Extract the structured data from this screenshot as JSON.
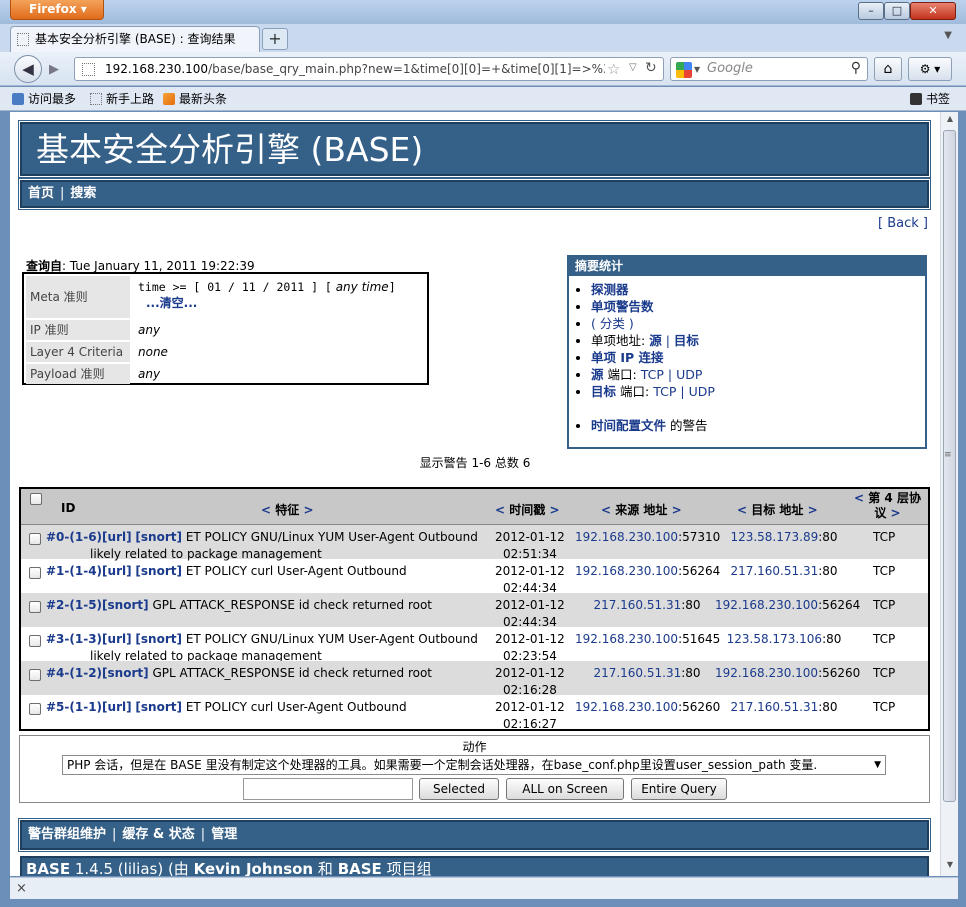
{
  "browser": {
    "app_button": "Firefox",
    "window_buttons": {
      "minimize": "–",
      "maximize": "□",
      "close": "✕"
    },
    "tab_title": "基本安全分析引擎 (BASE) : 查询结果",
    "new_tab": "+",
    "url_host": "192.168.230.100",
    "url_path": "/base/base_qry_main.php?new=1&time[0][0]=+&time[0][1]=>%3D&ti",
    "search_placeholder": "Google",
    "bookmarks": [
      "访问最多",
      "新手上路",
      "最新头条",
      "书签"
    ]
  },
  "page": {
    "title": "基本安全分析引擎 (BASE)",
    "menu": [
      "首页",
      "搜索"
    ],
    "back_link": "[ Back ]",
    "query_label": "查询自",
    "query_time": ": Tue January 11, 2011 19:22:39",
    "criteria": {
      "meta_label": "Meta 准则",
      "meta_value": "time >= [ 01 / 11 / 2011 ] [",
      "meta_anytime": "any time",
      "meta_close": "]",
      "clear_link": "...清空...",
      "ip_label": "IP 准则",
      "ip_value": "any",
      "l4_label": "Layer 4 Criteria",
      "l4_value": "none",
      "payload_label": "Payload 准则",
      "payload_value": "any"
    },
    "summary": {
      "header": "摘要统计",
      "sensors": "探测器",
      "unique_alerts": "单项警告数",
      "categories": "( 分类 )",
      "unique_addr_label": "单项地址:",
      "addr_src": "源",
      "addr_dst": "目标",
      "unique_ip_links": "单项 IP 连接",
      "src_port_label": "源",
      "dst_port_label": "目标",
      "port_word": "端口:",
      "tcp": "TCP",
      "udp": "UDP",
      "time_profile": "时间配置文件",
      "time_profile_suffix": "的警告"
    },
    "count_text": "显示警告 1-6 总数 6",
    "table": {
      "headers": {
        "id": "ID",
        "signature": "特征",
        "timestamp": "时间戳",
        "source": "来源 地址",
        "dest": "目标 地址",
        "proto_line1": "第 4 层协",
        "proto_line2": "议",
        "left_arrow": "<",
        "right_arrow": ">"
      },
      "rows": [
        {
          "id": "#0-(1-6)",
          "tags": [
            "[url]",
            "[snort]"
          ],
          "sig1": "ET POLICY GNU/Linux YUM User-Agent Outbound",
          "sig2": "likely related to package management",
          "date": "2012-01-12",
          "time": "02:51:34",
          "src_ip": "192.168.230.100",
          "src_port": ":57310",
          "dst_ip": "123.58.173.89",
          "dst_port": ":80",
          "proto": "TCP"
        },
        {
          "id": "#1-(1-4)",
          "tags": [
            "[url]",
            "[snort]"
          ],
          "sig1": "ET POLICY curl User-Agent Outbound",
          "sig2": "",
          "date": "2012-01-12",
          "time": "02:44:34",
          "src_ip": "192.168.230.100",
          "src_port": ":56264",
          "dst_ip": "217.160.51.31",
          "dst_port": ":80",
          "proto": "TCP"
        },
        {
          "id": "#2-(1-5)",
          "tags": [
            "[snort]"
          ],
          "sig1": "GPL ATTACK_RESPONSE id check returned root",
          "sig2": "",
          "date": "2012-01-12",
          "time": "02:44:34",
          "src_ip": "217.160.51.31",
          "src_port": ":80",
          "dst_ip": "192.168.230.100",
          "dst_port": ":56264",
          "proto": "TCP"
        },
        {
          "id": "#3-(1-3)",
          "tags": [
            "[url]",
            "[snort]"
          ],
          "sig1": "ET POLICY GNU/Linux YUM User-Agent Outbound",
          "sig2": "likely related to package management",
          "date": "2012-01-12",
          "time": "02:23:54",
          "src_ip": "192.168.230.100",
          "src_port": ":51645",
          "dst_ip": "123.58.173.106",
          "dst_port": ":80",
          "proto": "TCP"
        },
        {
          "id": "#4-(1-2)",
          "tags": [
            "[snort]"
          ],
          "sig1": "GPL ATTACK_RESPONSE id check returned root",
          "sig2": "",
          "date": "2012-01-12",
          "time": "02:16:28",
          "src_ip": "217.160.51.31",
          "src_port": ":80",
          "dst_ip": "192.168.230.100",
          "dst_port": ":56260",
          "proto": "TCP"
        },
        {
          "id": "#5-(1-1)",
          "tags": [
            "[url]",
            "[snort]"
          ],
          "sig1": "ET POLICY curl User-Agent Outbound",
          "sig2": "",
          "date": "2012-01-12",
          "time": "02:16:27",
          "src_ip": "192.168.230.100",
          "src_port": ":56260",
          "dst_ip": "217.160.51.31",
          "dst_port": ":80",
          "proto": "TCP"
        }
      ]
    },
    "action": {
      "label": "动作",
      "select_text": "PHP 会话，但是在 BASE 里没有制定这个处理器的工具。如果需要一个定制会话处理器，在base_conf.php里设置user_session_path 变量.",
      "btn_selected": "Selected",
      "btn_all": "ALL on Screen",
      "btn_entire": "Entire Query"
    },
    "footer_nav": [
      "警告群组维护",
      "缓存 & 状态",
      "管理"
    ],
    "footer_version_a": "BASE",
    "footer_version_b": "1.4.5 (lilias) (由",
    "footer_version_c": "Kevin Johnson",
    "footer_version_d": "和",
    "footer_version_e": "BASE",
    "footer_version_f": "项目组"
  },
  "colors": {
    "header_blue": "#356088",
    "link_blue": "#1a3a8c",
    "row_gray": "#dcdcdc"
  }
}
